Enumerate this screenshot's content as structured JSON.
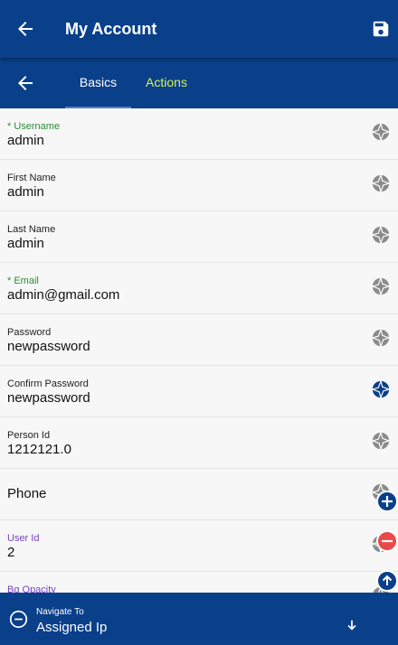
{
  "header": {
    "title": "My Account"
  },
  "tabs": [
    {
      "label": "Basics",
      "active": true
    },
    {
      "label": "Actions",
      "active": false
    }
  ],
  "fields": [
    {
      "label": "* Username",
      "value": "admin",
      "required": true
    },
    {
      "label": "First Name",
      "value": "admin"
    },
    {
      "label": "Last Name",
      "value": "admin"
    },
    {
      "label": "* Email",
      "value": "admin@gmail.com",
      "required": true
    },
    {
      "label": "Password",
      "value": "newpassword"
    },
    {
      "label": "Confirm Password",
      "value": "newpassword",
      "icon_active": true
    },
    {
      "label": "Person Id",
      "value": "1212121.0"
    },
    {
      "label": "Phone",
      "value": ""
    },
    {
      "label": "User Id",
      "value": "2"
    },
    {
      "label": "Bg Opacity",
      "value": ""
    }
  ],
  "navigate": {
    "label": "Navigate To",
    "value": "Assigned Ip"
  },
  "icons": {
    "back": "arrow-left-icon",
    "save": "save-icon",
    "field": "aperture-icon",
    "add": "plus-icon",
    "remove": "minus-icon",
    "up": "arrow-up-icon",
    "navigate": "minus-circle-icon",
    "down": "arrow-down-icon"
  },
  "colors": {
    "primary": "#0a3f8a",
    "accent_tab": "#d9f25a",
    "required_label": "#2e8b3a",
    "user_id_label": "#7a3fc2",
    "remove_button": "#e84a4a"
  }
}
